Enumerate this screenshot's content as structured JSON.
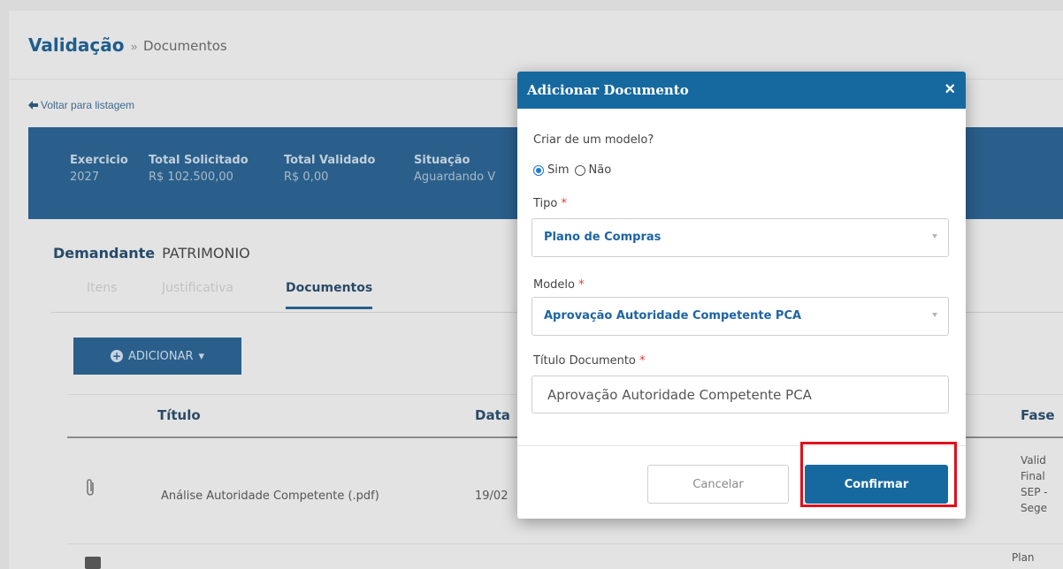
{
  "header": {
    "title": "Validação",
    "separator": "»",
    "subtitle": "Documentos"
  },
  "back_link": "Voltar para listagem",
  "summary": [
    {
      "label": "Exercicio",
      "value": "2027"
    },
    {
      "label": "Total Solicitado",
      "value": "R$ 102.500,00"
    },
    {
      "label": "Total Validado",
      "value": "R$ 0,00"
    },
    {
      "label": "Situação",
      "value": "Aguardando V"
    }
  ],
  "demandante": {
    "label": "Demandante",
    "value": "PATRIMONIO"
  },
  "tabs": [
    {
      "label": "Itens"
    },
    {
      "label": "Justificativa"
    },
    {
      "label": "Documentos"
    }
  ],
  "add_button": "ADICIONAR",
  "table": {
    "headers": {
      "titulo": "Título",
      "data": "Data",
      "fase": "Fase"
    },
    "rows": [
      {
        "titulo": "Análise Autoridade Competente (.pdf)",
        "data": "19/02",
        "fase": [
          "Valid",
          "Final",
          "SEP -",
          "Sege"
        ]
      }
    ],
    "next_row_fase": "Plan"
  },
  "modal": {
    "title": "Adicionar Documento",
    "close": "×",
    "question": "Criar de um modelo?",
    "options": [
      "Sim",
      "Não"
    ],
    "selected_option": "Sim",
    "tipo_label": "Tipo",
    "tipo_value": "Plano de Compras",
    "modelo_label": "Modelo",
    "modelo_value": "Aprovação Autoridade Competente PCA",
    "titulo_label": "Título Documento",
    "titulo_value": "Aprovação Autoridade Competente PCA",
    "required_mark": "*",
    "cancel": "Cancelar",
    "confirm": "Confirmar"
  },
  "colors": {
    "primary": "#16699f",
    "highlight": "#e0101b",
    "required": "#e0393b"
  }
}
